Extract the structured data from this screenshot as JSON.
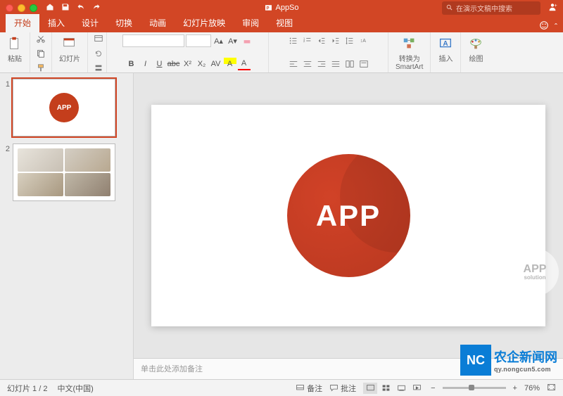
{
  "titlebar": {
    "doc_name": "AppSo",
    "search_placeholder": "在演示文稿中搜索"
  },
  "tabs": {
    "items": [
      {
        "label": "开始",
        "active": true
      },
      {
        "label": "插入",
        "active": false
      },
      {
        "label": "设计",
        "active": false
      },
      {
        "label": "切换",
        "active": false
      },
      {
        "label": "动画",
        "active": false
      },
      {
        "label": "幻灯片放映",
        "active": false
      },
      {
        "label": "审阅",
        "active": false
      },
      {
        "label": "视图",
        "active": false
      }
    ]
  },
  "ribbon": {
    "paste": "粘贴",
    "slides": "幻灯片",
    "smartart": "转换为\nSmartArt",
    "insert": "插入",
    "draw": "绘图"
  },
  "slides": {
    "items": [
      {
        "n": "1",
        "logo_text": "APP"
      },
      {
        "n": "2"
      }
    ],
    "main_logo": "APP"
  },
  "watermark": {
    "line1": "APP",
    "line2": "solution"
  },
  "notes": {
    "placeholder": "单击此处添加备注"
  },
  "branding": {
    "badge": "NC",
    "cn": "农企新闻网",
    "url": "qy.nongcun5.com"
  },
  "status": {
    "slide_info": "幻灯片 1 / 2",
    "lang": "中文(中国)",
    "notes_btn": "备注",
    "comments_btn": "批注",
    "zoom": "76%"
  }
}
